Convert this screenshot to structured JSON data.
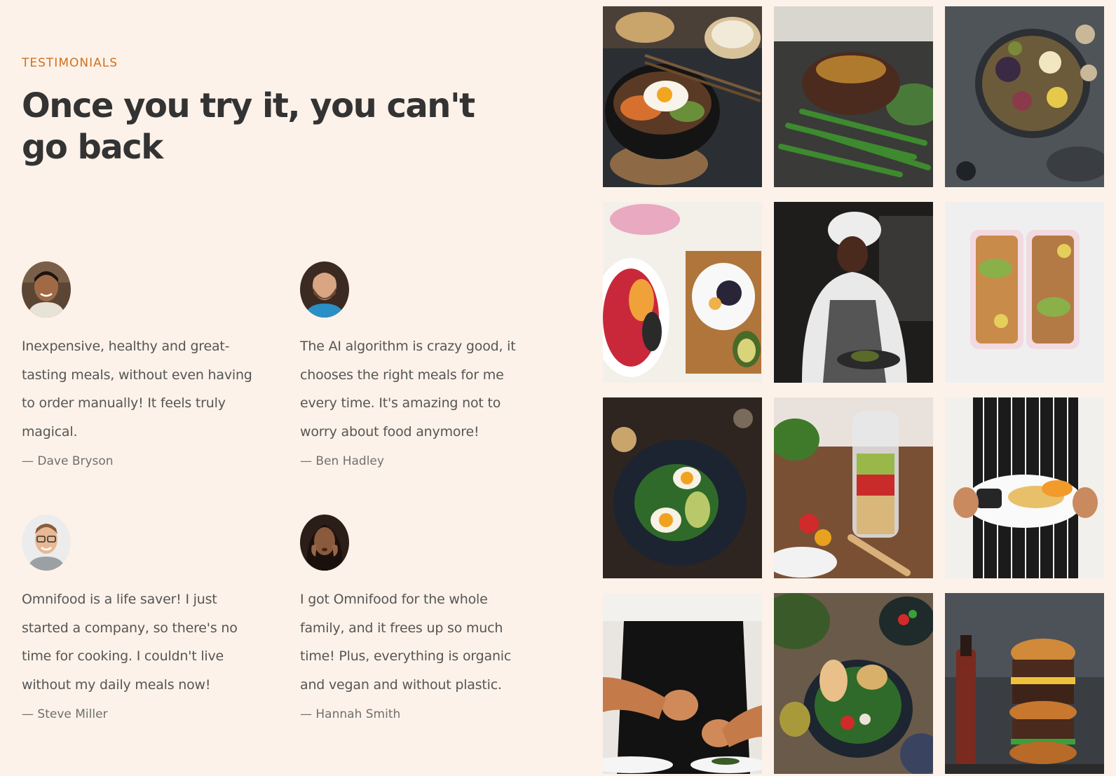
{
  "section": {
    "subheading": "TESTIMONIALS",
    "heading": "Once you try it, you can't go back"
  },
  "testimonials": [
    {
      "quote": "Inexpensive, healthy and great-tasting meals, without even having to order manually! It feels truly magical.",
      "name": "— Dave Bryson"
    },
    {
      "quote": "The AI algorithm is crazy good, it chooses the right meals for me every time. It's amazing not to worry about food anymore!",
      "name": "— Ben Hadley"
    },
    {
      "quote": "Omnifood is a life saver! I just started a company, so there's no time for cooking. I couldn't live without my daily meals now!",
      "name": "— Steve Miller"
    },
    {
      "quote": "I got Omnifood for the whole family, and it frees up so much time! Plus, everything is organic and vegan and without plastic.",
      "name": "— Hannah Smith"
    }
  ],
  "colors": {
    "background": "#fdf2e9",
    "accent": "#cf711f",
    "heading": "#333333",
    "body_text": "#555555"
  },
  "gallery": [
    {
      "icon": "bibimbap-bowl-photo"
    },
    {
      "icon": "steak-green-beans-photo"
    },
    {
      "icon": "fruit-platter-photo"
    },
    {
      "icon": "fruit-bowl-photo"
    },
    {
      "icon": "chef-cooking-photo"
    },
    {
      "icon": "meal-prep-containers-photo"
    },
    {
      "icon": "egg-salad-plate-photo"
    },
    {
      "icon": "salad-jar-photo"
    },
    {
      "icon": "plated-dish-photo"
    },
    {
      "icon": "chef-plating-photo"
    },
    {
      "icon": "chickpea-salad-bowl-photo"
    },
    {
      "icon": "burger-stack-photo"
    }
  ]
}
